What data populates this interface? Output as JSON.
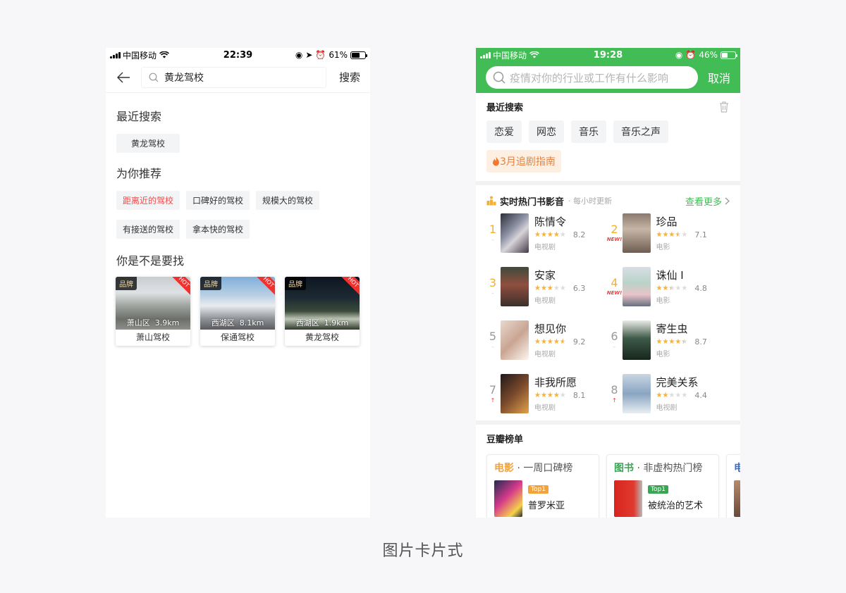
{
  "left": {
    "status": {
      "carrier": "中国移动",
      "time": "22:39",
      "battery": "61%",
      "battery_level": 0.61
    },
    "search": {
      "query": "黄龙驾校",
      "action": "搜索"
    },
    "recent": {
      "title": "最近搜索",
      "items": [
        "黄龙驾校"
      ]
    },
    "recommend": {
      "title": "为你推荐",
      "items": [
        "距离近的驾校",
        "口碑好的驾校",
        "规模大的驾校",
        "有接送的驾校",
        "拿本快的驾校"
      ]
    },
    "suggest": {
      "title": "你是不是要找",
      "cards": [
        {
          "brand": "品牌",
          "hot": "HOT",
          "district": "萧山区",
          "distance": "3.9km",
          "name": "萧山驾校"
        },
        {
          "brand": "品牌",
          "hot": "HOT",
          "district": "西湖区",
          "distance": "8.1km",
          "name": "保通驾校"
        },
        {
          "brand": "品牌",
          "hot": "HOT",
          "district": "西湖区",
          "distance": "1.9km",
          "name": "黄龙驾校"
        }
      ]
    }
  },
  "right": {
    "status": {
      "carrier": "中国移动",
      "time": "19:28",
      "battery": "46%",
      "battery_level": 0.46
    },
    "search": {
      "placeholder": "疫情对你的行业或工作有什么影响",
      "cancel": "取消"
    },
    "recent": {
      "title": "最近搜索",
      "items": [
        "恋爱",
        "网恋",
        "音乐",
        "音乐之声"
      ],
      "guide": "3月追剧指南"
    },
    "hot": {
      "title": "实时热门书影音",
      "subtitle": "每小时更新",
      "more": "查看更多",
      "items": [
        {
          "rank": "1",
          "trend": "–",
          "title": "陈情令",
          "rating": "8.2",
          "kind": "电视剧"
        },
        {
          "rank": "2",
          "trend": "NEW!",
          "title": "珍品",
          "rating": "7.1",
          "kind": "电影"
        },
        {
          "rank": "3",
          "trend": "–",
          "title": "安家",
          "rating": "6.3",
          "kind": "电视剧"
        },
        {
          "rank": "4",
          "trend": "NEW!",
          "title": "诛仙 I",
          "rating": "4.8",
          "kind": "电影"
        },
        {
          "rank": "5",
          "trend": "–",
          "title": "想见你",
          "rating": "9.2",
          "kind": "电视剧"
        },
        {
          "rank": "6",
          "trend": "–",
          "title": "寄生虫",
          "rating": "8.7",
          "kind": "电影"
        },
        {
          "rank": "7",
          "trend": "↑",
          "title": "非我所愿",
          "rating": "8.1",
          "kind": "电视剧"
        },
        {
          "rank": "8",
          "trend": "↑",
          "title": "完美关系",
          "rating": "4.4",
          "kind": "电视剧"
        }
      ]
    },
    "lists": {
      "title": "豆瓣榜单",
      "cards": [
        {
          "category": "电影",
          "name": "· 一周口碑榜",
          "badge": "Top1",
          "item": "普罗米亚",
          "color": "#f2a33a"
        },
        {
          "category": "图书",
          "name": "· 非虚构热门榜",
          "badge": "Top1",
          "item": "被统治的艺术",
          "color": "#3aa552"
        },
        {
          "category": "电",
          "name": "",
          "badge": "",
          "item": "",
          "color": "#3b6fc8"
        }
      ]
    }
  },
  "caption": "图片卡片式",
  "colors": {
    "douban_green": "#42bd56",
    "gold_rank": "#f4b030",
    "star": "#f7b33b",
    "hot_red": "#f0312e"
  }
}
